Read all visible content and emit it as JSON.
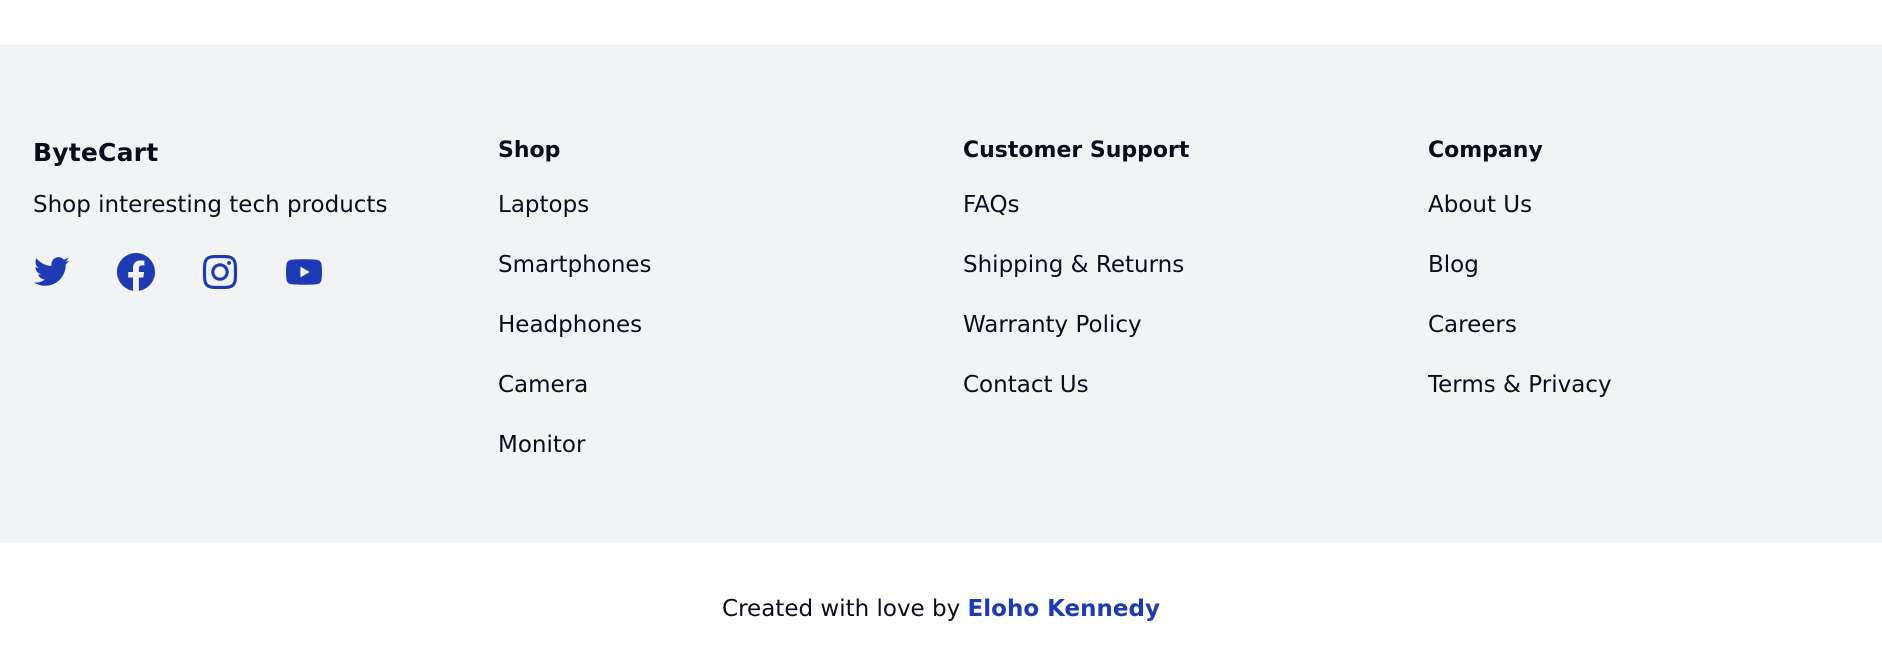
{
  "brand": {
    "name": "ByteCart",
    "tagline": "Shop interesting tech products",
    "socials": [
      {
        "icon": "twitter-icon"
      },
      {
        "icon": "facebook-icon"
      },
      {
        "icon": "instagram-icon"
      },
      {
        "icon": "youtube-icon"
      }
    ]
  },
  "columns": {
    "shop": {
      "title": "Shop",
      "links": [
        "Laptops",
        "Smartphones",
        "Headphones",
        "Camera",
        "Monitor"
      ]
    },
    "support": {
      "title": "Customer Support",
      "links": [
        "FAQs",
        "Shipping & Returns",
        "Warranty Policy",
        "Contact Us"
      ]
    },
    "company": {
      "title": "Company",
      "links": [
        "About Us",
        "Blog",
        "Careers",
        "Terms & Privacy"
      ]
    }
  },
  "credit": {
    "prefix": "Created with love by",
    "author": "Eloho Kennedy"
  },
  "colors": {
    "accent": "#1f3bb3",
    "footer_bg": "#f2f3f5",
    "text": "#0b0b1a"
  }
}
